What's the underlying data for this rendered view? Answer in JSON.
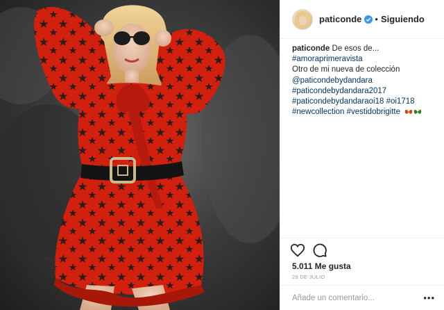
{
  "post": {
    "image_alt": "Woman in red star-print dress with black belt and sunglasses",
    "likes_text": "5.011 Me gusta",
    "date_text": "29 DE JULIO"
  },
  "header": {
    "username": "paticonde",
    "separator": "•",
    "follow_label": "Siguiendo"
  },
  "caption": {
    "username": "paticonde",
    "first_text": "De esos de...",
    "tag1": "#amoraprimeravista",
    "text2": "Otro de mi nueva de colección",
    "mention": "@paticondebydandara",
    "tag2": "#paticondebydandara2017",
    "tag3": "#paticondebydandaraoi18",
    "tag4": "#oi1718",
    "tag5": "#newcollection",
    "tag6": "#vestidobrigitte"
  },
  "comment": {
    "placeholder": "Añade un comentario...",
    "more_label": "•••"
  },
  "colors": {
    "hashtag": "#003569",
    "verified": "#3897f0",
    "dress": "#d2200f",
    "border": "#efefef"
  },
  "icons": [
    "verified-badge-icon",
    "heart-icon",
    "comment-icon",
    "more-options-icon",
    "butterfly-emoji-icon"
  ]
}
